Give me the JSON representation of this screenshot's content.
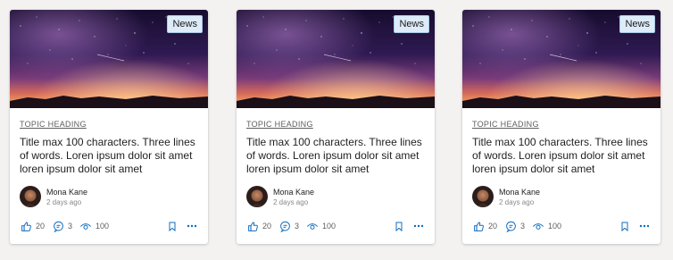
{
  "colors": {
    "accent": "#0f6cbd",
    "badge_bg": "#deecf9"
  },
  "cards": [
    {
      "badge": "News",
      "topic": "TOPIC HEADING",
      "title": "Title max 100 characters. Three lines of words. Loren ipsum dolor sit amet loren ipsum dolor sit amet",
      "author": "Mona Kane",
      "date": "2 days ago",
      "likes": "20",
      "comments": "3",
      "views": "100",
      "icons": [
        "like-icon",
        "comment-icon",
        "views-icon",
        "bookmark-icon",
        "more-icon"
      ]
    },
    {
      "badge": "News",
      "topic": "TOPIC HEADING",
      "title": "Title max 100 characters. Three lines of words. Loren ipsum dolor sit amet loren ipsum dolor sit amet",
      "author": "Mona Kane",
      "date": "2 days ago",
      "likes": "20",
      "comments": "3",
      "views": "100",
      "icons": [
        "like-icon",
        "comment-icon",
        "views-icon",
        "bookmark-icon",
        "more-icon"
      ]
    },
    {
      "badge": "News",
      "topic": "TOPIC HEADING",
      "title": "Title max 100 characters. Three lines of words. Loren ipsum dolor sit amet loren ipsum dolor sit amet",
      "author": "Mona Kane",
      "date": "2 days ago",
      "likes": "20",
      "comments": "3",
      "views": "100",
      "icons": [
        "like-icon",
        "comment-icon",
        "views-icon",
        "bookmark-icon",
        "more-icon"
      ]
    }
  ]
}
